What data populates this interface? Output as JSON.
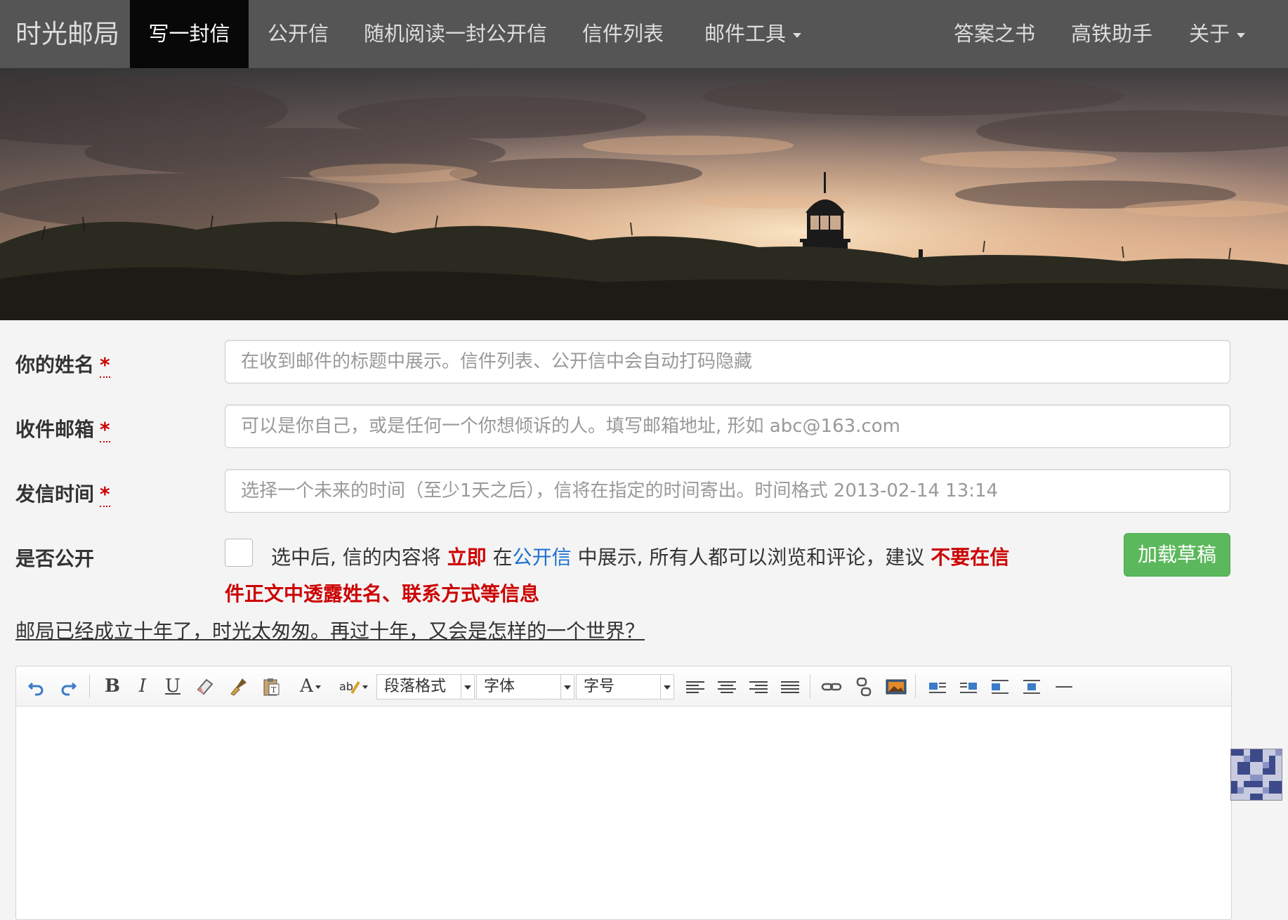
{
  "nav": {
    "brand": "时光邮局",
    "items": [
      "写一封信",
      "公开信",
      "随机阅读一封公开信",
      "信件列表",
      "邮件工具"
    ],
    "right_items": [
      "答案之书",
      "高铁助手",
      "关于"
    ]
  },
  "form": {
    "name": {
      "label": "你的姓名",
      "required_mark": "*",
      "placeholder": "在收到邮件的标题中展示。信件列表、公开信中会自动打码隐藏"
    },
    "email": {
      "label": "收件邮箱",
      "required_mark": "*",
      "placeholder": "可以是你自己，或是任何一个你想倾诉的人。填写邮箱地址, 形如 abc@163.com"
    },
    "send_time": {
      "label": "发信时间",
      "required_mark": "*",
      "placeholder": "选择一个未来的时间（至少1天之后），信将在指定的时间寄出。时间格式 2013-02-14 13:14"
    },
    "public": {
      "label": "是否公开",
      "checked": false,
      "note_part1": "选中后, 信的内容将",
      "note_emph1": "立即",
      "note_part2": "在",
      "note_link": "公开信",
      "note_part3": "中展示, 所有人都可以浏览和评论，建议",
      "note_emph2": "不要在信件正文中透露姓名、联系方式等信息"
    },
    "load_draft_button": "加载草稿"
  },
  "tagline": "邮局已经成立十年了，时光太匆匆。再过十年，又会是怎样的一个世界？",
  "editor": {
    "toolbar": {
      "paragraph_format": "段落格式",
      "font_family": "字体",
      "font_size": "字号",
      "icons": [
        "undo-icon",
        "redo-icon",
        "bold-icon",
        "italic-icon",
        "underline-icon",
        "eraser-icon",
        "format-brush-icon",
        "paste-text-icon",
        "font-color-icon",
        "highlight-color-icon",
        "align-left-icon",
        "align-center-icon",
        "align-right-icon",
        "align-justify-icon",
        "link-icon",
        "unlink-icon",
        "image-icon",
        "float-left-icon",
        "float-right-icon",
        "float-none-icon",
        "center-block-icon",
        "horizontal-rule-icon"
      ],
      "bold_glyph": "B",
      "italic_glyph": "I",
      "underline_glyph": "U",
      "font_color_glyph": "A",
      "hr_glyph": "—"
    },
    "content": ""
  },
  "colors": {
    "navbar_bg": "#555555",
    "navbar_active_bg": "#080808",
    "accent_red": "#cc0000",
    "link_blue": "#1e6fd0",
    "success_green": "#5cb85c"
  }
}
